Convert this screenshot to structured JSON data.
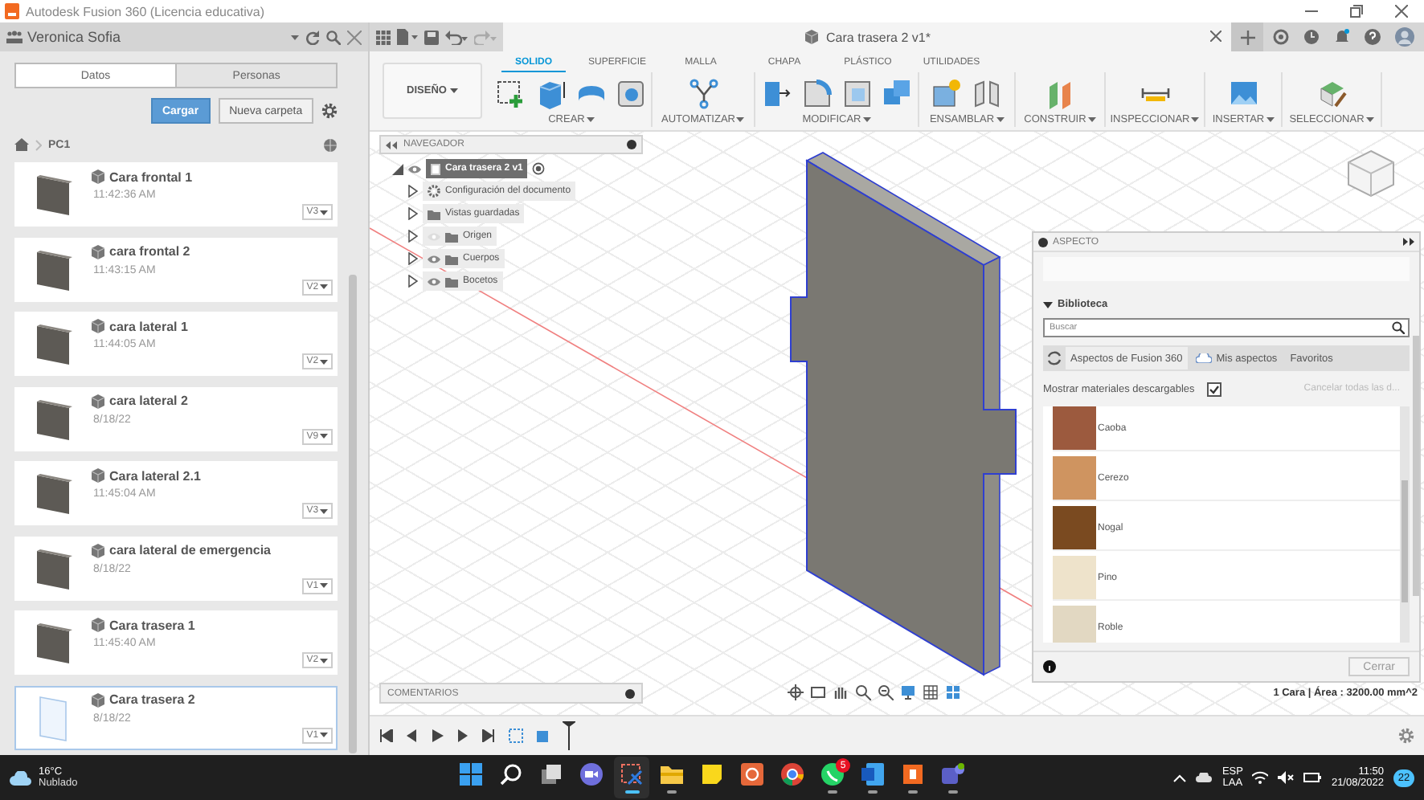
{
  "title_bar": {
    "title": "Autodesk Fusion 360 (Licencia educativa)"
  },
  "data_panel": {
    "user": "Veronica Sofia",
    "tabs": [
      {
        "label": "Datos",
        "selected": true
      },
      {
        "label": "Personas",
        "selected": false
      }
    ],
    "buttons": [
      {
        "label": "Cargar",
        "kind": "primary"
      },
      {
        "label": "Nueva carpeta",
        "kind": "secondary"
      }
    ],
    "breadcrumb": "PC1",
    "files": [
      {
        "name": "Cara frontal 1",
        "time": "11:42:36 AM",
        "version": "V3",
        "selected": false
      },
      {
        "name": "cara frontal 2",
        "time": "11:43:15 AM",
        "version": "V2",
        "selected": false
      },
      {
        "name": "cara lateral 1",
        "time": "11:44:05 AM",
        "version": "V2",
        "selected": false
      },
      {
        "name": "cara lateral 2",
        "time": "8/18/22",
        "version": "V9",
        "selected": false
      },
      {
        "name": "Cara lateral 2.1",
        "time": "11:45:04 AM",
        "version": "V3",
        "selected": false
      },
      {
        "name": "cara lateral de emergencia",
        "time": "8/18/22",
        "version": "V1",
        "selected": false
      },
      {
        "name": "Cara trasera 1",
        "time": "11:45:40 AM",
        "version": "V2",
        "selected": false
      },
      {
        "name": "Cara trasera 2",
        "time": "8/18/22",
        "version": "V1",
        "selected": true
      }
    ]
  },
  "document_tab": {
    "title": "Cara trasera 2 v1*"
  },
  "workspace": "DISEÑO",
  "toolbar_tabs": [
    {
      "label": "SOLIDO",
      "selected": true
    },
    {
      "label": "SUPERFICIE",
      "selected": false
    },
    {
      "label": "MALLA",
      "selected": false
    },
    {
      "label": "CHAPA",
      "selected": false
    },
    {
      "label": "PLÁSTICO",
      "selected": false
    },
    {
      "label": "UTILIDADES",
      "selected": false
    }
  ],
  "tool_groups": [
    "CREAR",
    "AUTOMATIZAR",
    "MODIFICAR",
    "ENSAMBLAR",
    "CONSTRUIR",
    "INSPECCIONAR",
    "INSERTAR",
    "SELECCIONAR"
  ],
  "navigator": {
    "title": "NAVEGADOR",
    "root": {
      "label": "Cara trasera 2 v1",
      "visible": true,
      "children": [
        {
          "label": "Configuración del documento",
          "kind": "settings"
        },
        {
          "label": "Vistas guardadas",
          "kind": "folder"
        },
        {
          "label": "Origen",
          "kind": "folder",
          "visible": false
        },
        {
          "label": "Cuerpos",
          "kind": "folder",
          "visible": true
        },
        {
          "label": "Bocetos",
          "kind": "folder",
          "visible": true
        }
      ]
    }
  },
  "comments": {
    "title": "COMENTARIOS"
  },
  "status": "1 Cara | Área : 3200.00 mm^2",
  "appearance": {
    "title": "ASPECTO",
    "section": "Biblioteca",
    "search": {
      "placeholder": "Buscar"
    },
    "tabs": [
      {
        "label": "Aspectos de Fusion 360",
        "selected": true
      },
      {
        "label": "Mis aspectos",
        "selected": false
      },
      {
        "label": "Favoritos",
        "selected": false
      }
    ],
    "show_downloadable": {
      "label": "Mostrar materiales descargables",
      "checked": true
    },
    "cancel_link": {
      "label": "Cancelar todas las d...",
      "disabled": true
    },
    "materials": [
      {
        "name": "Caoba",
        "color": "#9c5a3e"
      },
      {
        "name": "Cerezo",
        "color": "#cf9460"
      },
      {
        "name": "Nogal",
        "color": "#7a4a20"
      },
      {
        "name": "Pino",
        "color": "#eee3cb"
      },
      {
        "name": "Roble",
        "color": "#e2d8c2"
      }
    ],
    "close_button": {
      "label": "Cerrar",
      "disabled": true
    }
  },
  "taskbar": {
    "weather": {
      "temperature": "16°C",
      "condition": "Nublado"
    },
    "apps": [
      {
        "kind": "start",
        "running": false,
        "active": false
      },
      {
        "kind": "search",
        "running": false,
        "active": false
      },
      {
        "kind": "taskview",
        "running": false,
        "active": false
      },
      {
        "kind": "meet",
        "running": false,
        "active": false
      },
      {
        "kind": "snip",
        "running": true,
        "active": true
      },
      {
        "kind": "explorer",
        "running": true,
        "active": false
      },
      {
        "kind": "notes",
        "running": false,
        "active": false
      },
      {
        "kind": "office",
        "running": false,
        "active": false
      },
      {
        "kind": "browser",
        "running": false,
        "active": false
      },
      {
        "kind": "chat",
        "running": true,
        "active": false,
        "badge": "5"
      },
      {
        "kind": "word",
        "running": true,
        "active": false
      },
      {
        "kind": "fusion",
        "running": true,
        "active": false
      },
      {
        "kind": "teams",
        "running": true,
        "active": false
      }
    ],
    "language": "ESP",
    "layout": "LAA",
    "time": "11:50",
    "date": "21/08/2022",
    "notifications": "22"
  }
}
